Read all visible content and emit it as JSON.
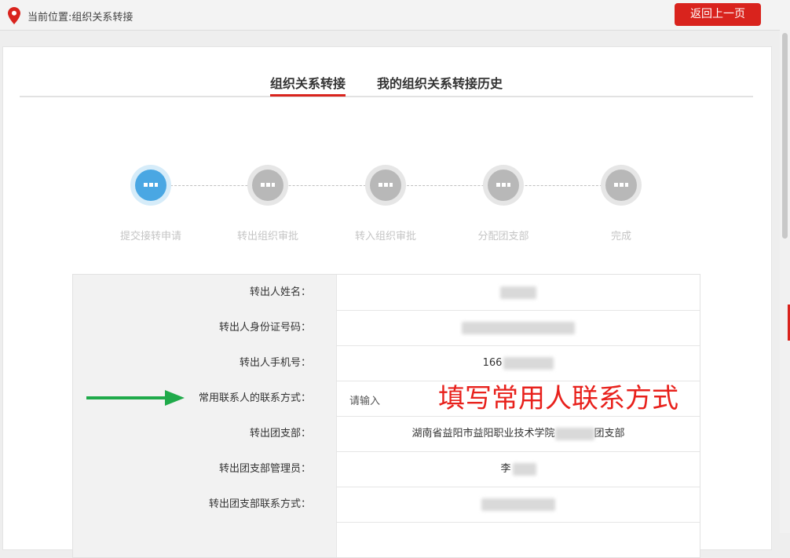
{
  "header": {
    "location": "当前位置:组织关系转接",
    "back_label": "返回上一页"
  },
  "tabs": [
    {
      "label": "组织关系转接",
      "active": true
    },
    {
      "label": "我的组织关系转接历史",
      "active": false
    }
  ],
  "steps": [
    {
      "label": "提交接转申请",
      "active": true
    },
    {
      "label": "转出组织审批",
      "active": false
    },
    {
      "label": "转入组织审批",
      "active": false
    },
    {
      "label": "分配团支部",
      "active": false
    },
    {
      "label": "完成",
      "active": false
    }
  ],
  "form": {
    "rows": [
      {
        "label": "转出人姓名：",
        "value": ""
      },
      {
        "label": "转出人身份证号码：",
        "value": ""
      },
      {
        "label": "转出人手机号：",
        "value": "166"
      },
      {
        "label": "常用联系人的联系方式：",
        "placeholder": "请输入"
      },
      {
        "label": "转出团支部：",
        "value_prefix": "湖南省益阳市益阳职业技术学院",
        "value_suffix": "团支部"
      },
      {
        "label": "转出团支部管理员：",
        "value": "李"
      },
      {
        "label": "转出团支部联系方式：",
        "value": ""
      }
    ]
  },
  "annotation": {
    "text": "填写常用人联系方式",
    "color": "#e8211c",
    "arrow_color": "#1faa4a"
  },
  "colors": {
    "accent": "#d9231d",
    "step_active": "#4aa7e3",
    "step_inactive": "#b8b8b8"
  }
}
